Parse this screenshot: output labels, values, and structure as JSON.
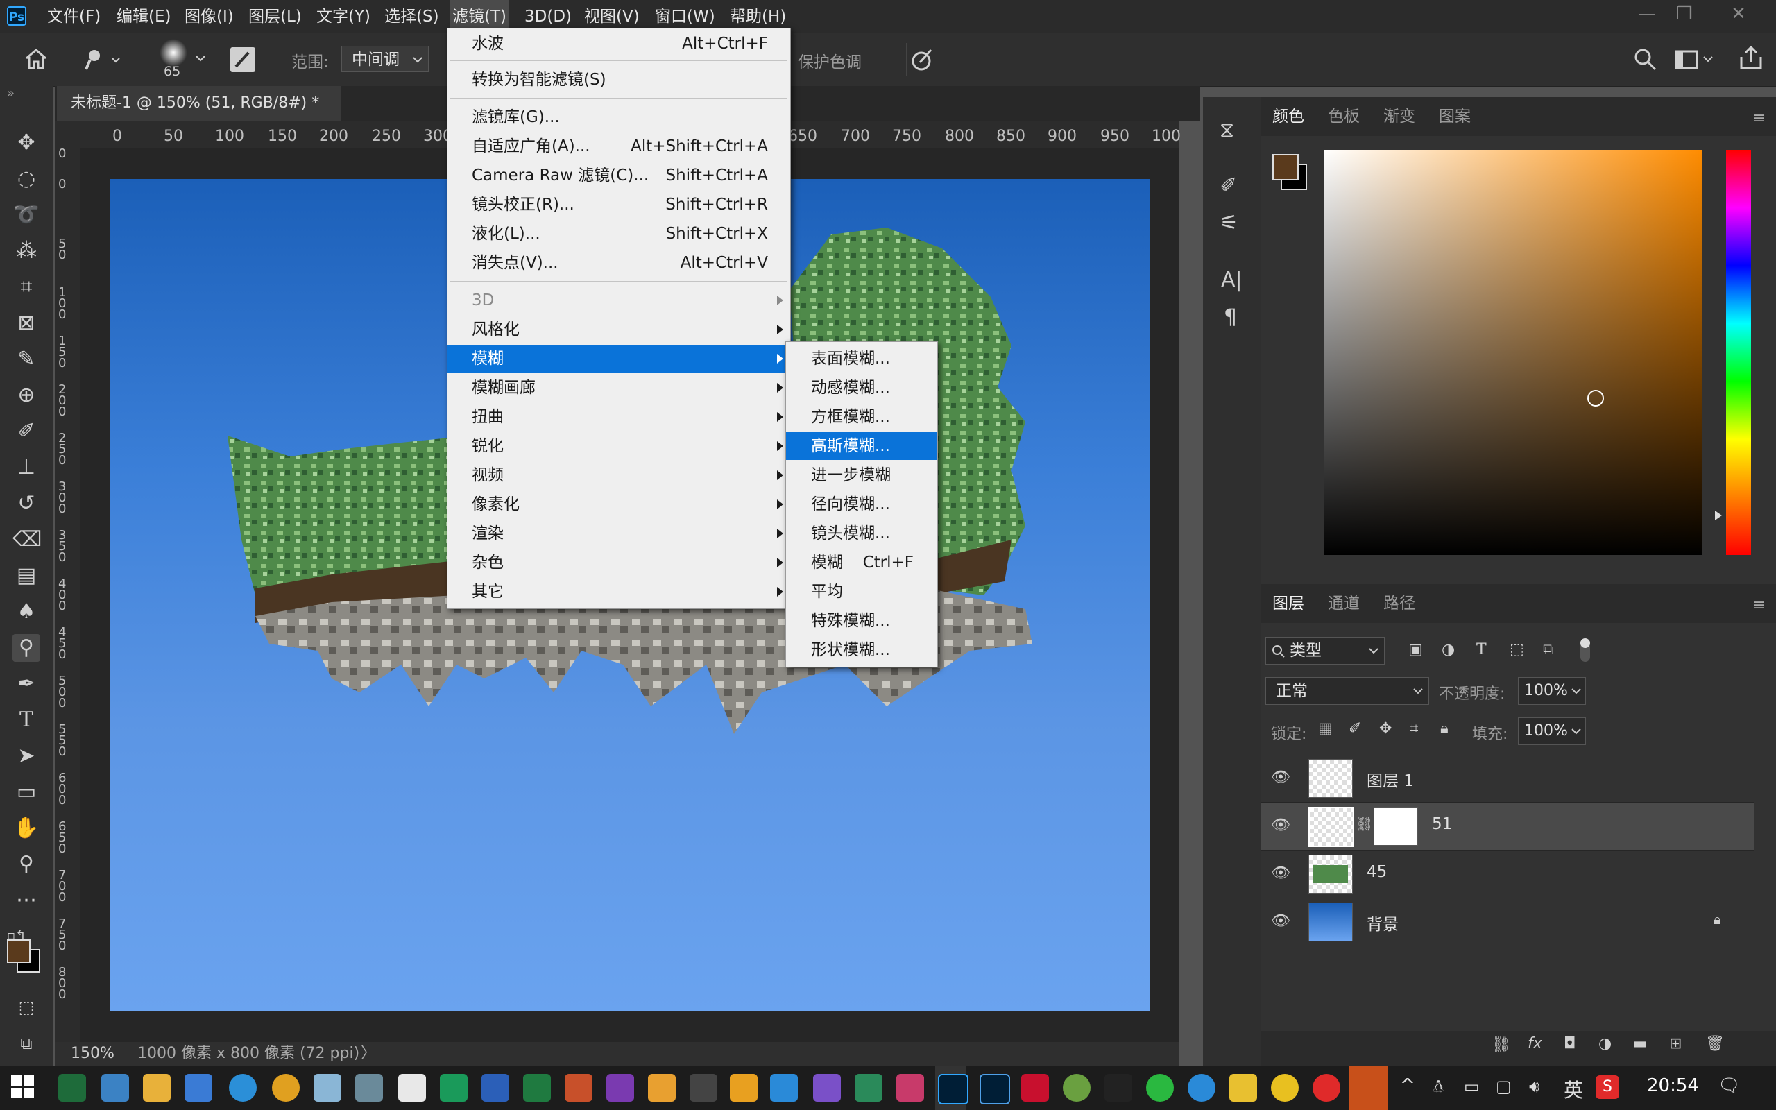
{
  "menubar": {
    "items": [
      "文件(F)",
      "编辑(E)",
      "图像(I)",
      "图层(L)",
      "文字(Y)",
      "选择(S)",
      "滤镜(T)",
      "3D(D)",
      "视图(V)",
      "窗口(W)",
      "帮助(H)"
    ],
    "window_buttons": {
      "minimize": "—",
      "restore": "❐",
      "close": "✕"
    }
  },
  "options": {
    "brush_size": "65",
    "range_label": "范围:",
    "range_value": "中间调",
    "protect_tones": "保护色调"
  },
  "document": {
    "tab_title": "未标题-1 @ 150% (51, RGB/8#) *",
    "tab_close": "×",
    "zoom": "150%",
    "size_info": "1000 像素 x 800 像素 (72 ppi)",
    "status_arrow": "〉"
  },
  "rulers": {
    "h_labels": [
      "0",
      "50",
      "100",
      "150",
      "200",
      "250",
      "300",
      "650",
      "700",
      "750",
      "800",
      "850",
      "900",
      "950",
      "100"
    ],
    "v_labels": [
      "0",
      "0",
      "50",
      "100",
      "150",
      "200",
      "250",
      "300",
      "350",
      "400",
      "450",
      "500",
      "550",
      "600",
      "650",
      "700",
      "750",
      "800"
    ]
  },
  "filter_menu": {
    "items": [
      {
        "label": "水波",
        "shortcut": "Alt+Ctrl+F"
      },
      {
        "label": "转换为智能滤镜(S)",
        "shortcut": ""
      },
      {
        "label": "滤镜库(G)...",
        "shortcut": ""
      },
      {
        "label": "自适应广角(A)...",
        "shortcut": "Alt+Shift+Ctrl+A"
      },
      {
        "label": "Camera Raw 滤镜(C)...",
        "shortcut": "Shift+Ctrl+A"
      },
      {
        "label": "镜头校正(R)...",
        "shortcut": "Shift+Ctrl+R"
      },
      {
        "label": "液化(L)...",
        "shortcut": "Shift+Ctrl+X"
      },
      {
        "label": "消失点(V)...",
        "shortcut": "Alt+Ctrl+V"
      },
      {
        "label": "3D",
        "shortcut": ""
      },
      {
        "label": "风格化",
        "shortcut": ""
      },
      {
        "label": "模糊",
        "shortcut": ""
      },
      {
        "label": "模糊画廊",
        "shortcut": ""
      },
      {
        "label": "扭曲",
        "shortcut": ""
      },
      {
        "label": "锐化",
        "shortcut": ""
      },
      {
        "label": "视频",
        "shortcut": ""
      },
      {
        "label": "像素化",
        "shortcut": ""
      },
      {
        "label": "渲染",
        "shortcut": ""
      },
      {
        "label": "杂色",
        "shortcut": ""
      },
      {
        "label": "其它",
        "shortcut": ""
      }
    ]
  },
  "blur_submenu": {
    "items": [
      {
        "label": "表面模糊...",
        "shortcut": ""
      },
      {
        "label": "动感模糊...",
        "shortcut": ""
      },
      {
        "label": "方框模糊...",
        "shortcut": ""
      },
      {
        "label": "高斯模糊...",
        "shortcut": ""
      },
      {
        "label": "进一步模糊",
        "shortcut": ""
      },
      {
        "label": "径向模糊...",
        "shortcut": ""
      },
      {
        "label": "镜头模糊...",
        "shortcut": ""
      },
      {
        "label": "模糊",
        "shortcut": "Ctrl+F"
      },
      {
        "label": "平均",
        "shortcut": ""
      },
      {
        "label": "特殊模糊...",
        "shortcut": ""
      },
      {
        "label": "形状模糊...",
        "shortcut": ""
      }
    ]
  },
  "color_panel": {
    "tabs": [
      "颜色",
      "色板",
      "渐变",
      "图案"
    ],
    "foreground": "#5a3a1c",
    "background": "#000000"
  },
  "layers_panel": {
    "tabs": [
      "图层",
      "通道",
      "路径"
    ],
    "filter_label": "类型",
    "blend_mode": "正常",
    "opacity_label": "不透明度:",
    "opacity_value": "100%",
    "lock_label": "锁定:",
    "fill_label": "填充:",
    "fill_value": "100%",
    "layers": [
      {
        "name": "图层 1",
        "selected": false
      },
      {
        "name": "51",
        "selected": true
      },
      {
        "name": "45",
        "selected": false
      },
      {
        "name": "背景",
        "selected": false
      }
    ]
  },
  "taskbar": {
    "time": "20:54",
    "ime": "英"
  },
  "icons": {
    "accent": "#0a73d9",
    "ps_logo": "Ps"
  }
}
